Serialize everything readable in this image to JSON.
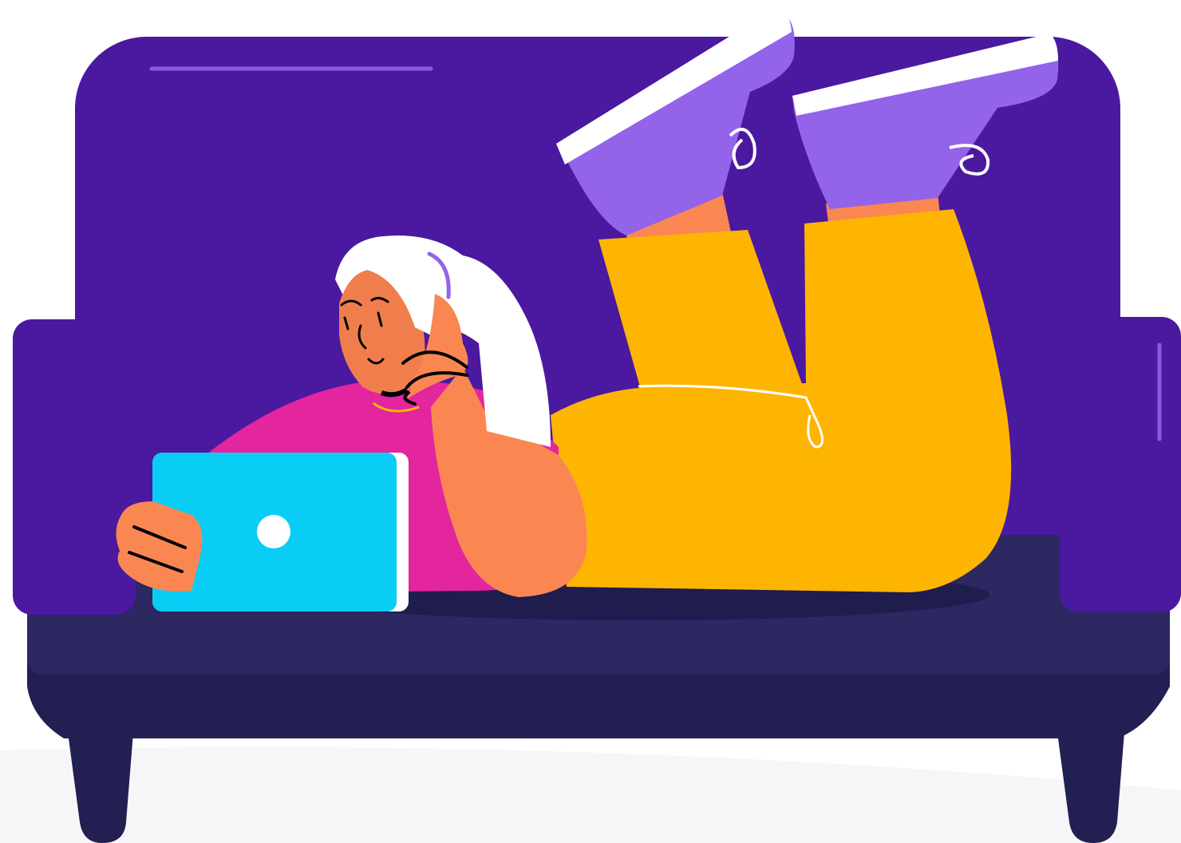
{
  "palette": {
    "background": "#ffffff",
    "floor": "#f6f6f9",
    "sofa_back": "#4b18a0",
    "sofa_highlight": "#8b5ae0",
    "sofa_seat": "#2d2762",
    "sofa_base": "#222052",
    "seat_shadow": "#1f1c4e",
    "skin": "#fa8752",
    "skin_shade": "#f07e4d",
    "hair": "#ffffff",
    "shirt": "#e3259e",
    "pants": "#fdb502",
    "shoe": "#9363ea",
    "shoe_sole": "#ffffff",
    "tablet": "#0acdf5",
    "tablet_edge": "#ffffff",
    "line_art": "#000000",
    "necklace": "#fdb502"
  },
  "icons": {
    "scene": "person-on-sofa-with-tablet-illustration"
  }
}
